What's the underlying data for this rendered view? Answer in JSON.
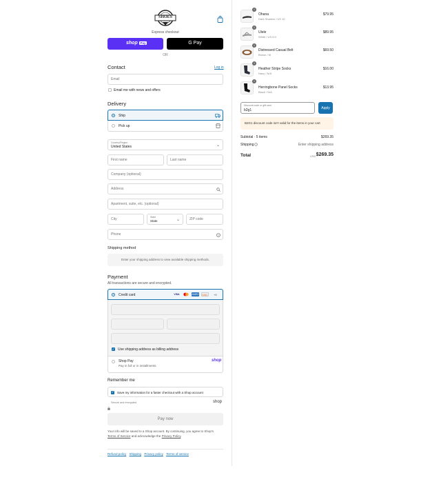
{
  "header": {
    "logo_text": "SHOES",
    "cart_icon": "shopping-bag-icon"
  },
  "express": {
    "label": "Express checkout",
    "shop_pay": "shop",
    "shop_pay_badge": "Pay",
    "gpay": "G Pay",
    "or": "OR"
  },
  "contact": {
    "title": "Contact",
    "login": "Log in",
    "email_placeholder": "Email",
    "news_label": "Email me with news and offers"
  },
  "delivery": {
    "title": "Delivery",
    "ship": "Ship",
    "pickup": "Pick up",
    "country_label": "Country/Region",
    "country_value": "United States",
    "first_name": "First name",
    "last_name": "Last name",
    "company": "Company (optional)",
    "address": "Address",
    "apartment": "Apartment, suite, etc. (optional)",
    "city": "City",
    "state_label": "State",
    "state_value": "State",
    "zip": "ZIP code",
    "phone": "Phone"
  },
  "shipping_method": {
    "title": "Shipping method",
    "message": "Enter your shipping address to view available shipping methods."
  },
  "payment": {
    "title": "Payment",
    "subtitle": "All transactions are secure and encrypted.",
    "credit_card": "Credit card",
    "cards": [
      "VISA",
      "MC",
      "AMEX",
      "DISC"
    ],
    "more_cards": "+5",
    "billing_same": "Use shipping address as billing address",
    "shop_pay": "Shop Pay",
    "shop_pay_sub": "Pay in full or in installments",
    "shop_pay_logo": "shop"
  },
  "remember": {
    "title": "Remember me",
    "save_label": "Save my information for a faster checkout with a Shop account",
    "secure": "Secure and encrypted",
    "shop_logo": "shop"
  },
  "pay_now": "Pay now",
  "legal": {
    "text1": "Your info will be saved to a Shop account. By continuing, you agree to Shop's",
    "terms": "Terms of Service",
    "text2": "and acknowledge the",
    "privacy": "Privacy Policy",
    "period": "."
  },
  "footer_links": [
    "Refund policy",
    "Shipping",
    "Privacy policy",
    "Terms of service"
  ],
  "cart": {
    "items": [
      {
        "qty": "1",
        "name": "Ohana",
        "variant": "Dark Shadow / US 10",
        "price": "$79.95"
      },
      {
        "qty": "1",
        "name": "Ulele",
        "variant": "White / US 8.0",
        "price": "$89.95"
      },
      {
        "qty": "1",
        "name": "Distressed Casual Belt",
        "variant": "Brown / M",
        "price": "$69.50"
      },
      {
        "qty": "1",
        "name": "Heather Stripe Socks",
        "variant": "Navy / N/A",
        "price": "$16.00"
      },
      {
        "qty": "1",
        "name": "Herringbone Panel Socks",
        "variant": "Black / N/A",
        "price": "$13.95"
      }
    ],
    "discount_label": "Discount code or gift card",
    "discount_value": "b2g1",
    "apply": "Apply",
    "discount_error": "B2G1 discount code isn't valid for the items in your cart",
    "subtotal_label": "Subtotal · 5 items",
    "subtotal_value": "$269.35",
    "shipping_label": "Shipping",
    "shipping_value": "Enter shipping address",
    "total_label": "Total",
    "currency": "USD",
    "total_value": "$269.35"
  },
  "colors": {
    "accent": "#1773b0",
    "shop_purple": "#5a31f4",
    "gpay_black": "#000000",
    "apply_blue": "#1773b0",
    "error_bg": "#fff4e5"
  }
}
